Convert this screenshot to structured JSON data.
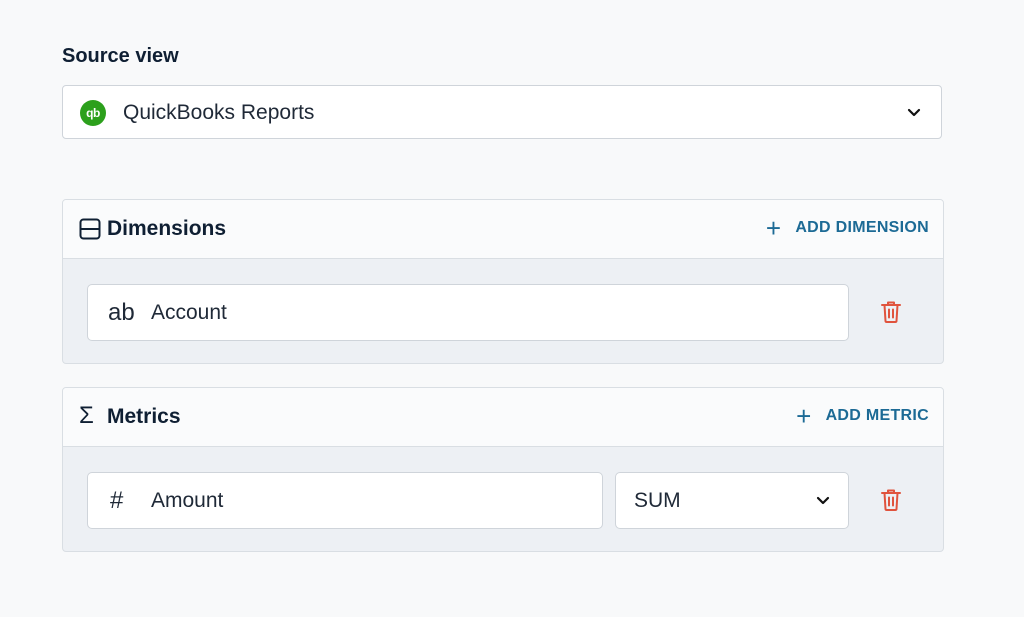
{
  "source": {
    "label": "Source view",
    "selected": "QuickBooks Reports",
    "logo_text": "qb",
    "logo_color": "#2ca01c",
    "chevron_icon": "chevron-down-icon"
  },
  "dimensions": {
    "title": "Dimensions",
    "icon": "table-rows-icon",
    "add_label": "ADD DIMENSION",
    "items": [
      {
        "type_glyph": "ab",
        "value": "Account"
      }
    ]
  },
  "metrics": {
    "title": "Metrics",
    "icon_glyph": "Σ",
    "add_label": "ADD METRIC",
    "items": [
      {
        "type_glyph": "#",
        "value": "Amount",
        "aggregation": "SUM"
      }
    ]
  },
  "colors": {
    "accent": "#1c6a95",
    "delete": "#e0533d"
  }
}
